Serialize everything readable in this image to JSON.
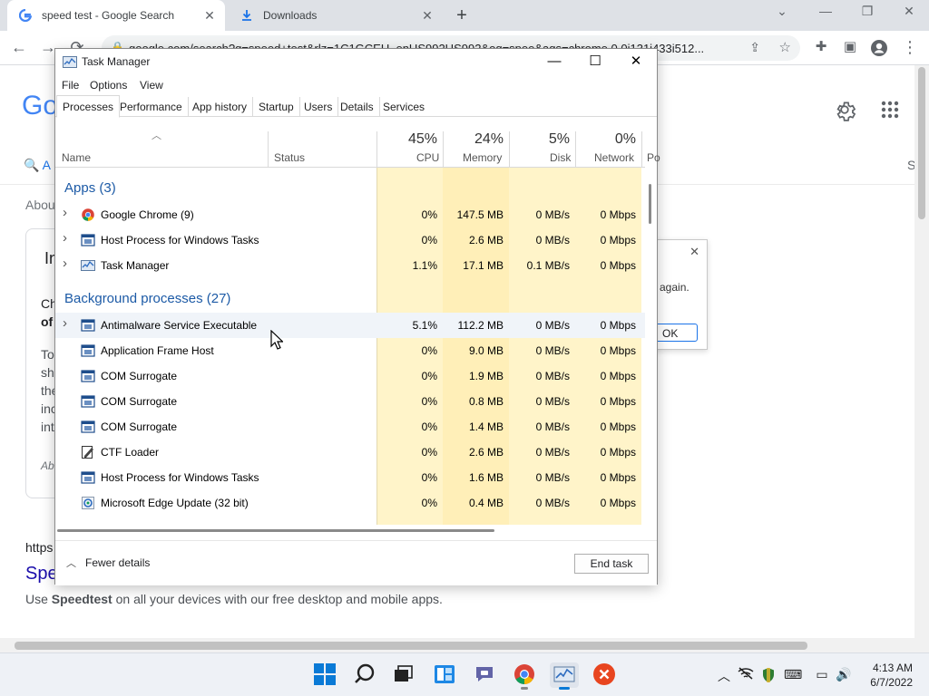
{
  "browser": {
    "tabs": [
      {
        "title": "speed test - Google Search",
        "active": true
      },
      {
        "title": "Downloads",
        "active": false
      }
    ],
    "new_tab": "+",
    "address": "google.com/search?q=speed+test&rlz=1C1GCEU_enUS992US992&oq=spee&aqs=chrome.0.0i131i433i512...",
    "nav": {
      "back": "←",
      "forward": "→",
      "reload": "⟳"
    }
  },
  "page": {
    "logo_partial": "Go",
    "search_tab_partial": "A",
    "about_partial": "Abou",
    "card_title_partial": "In",
    "card_lines": [
      "Ch",
      "of",
      "To",
      "sh",
      "the",
      "inc",
      "int"
    ],
    "card_italic_partial": "Ab",
    "url_partial": "https",
    "result_title_partial": "Spe",
    "result_snippet_prefix": "Use ",
    "result_snippet_bold": "Speedtest",
    "result_snippet_suffix": " on all your devices with our free desktop and mobile apps.",
    "right_tab_partial": "S"
  },
  "dialog_behind": {
    "text": "again.",
    "ok": "OK",
    "close": "✕"
  },
  "task_manager": {
    "title": "Task Manager",
    "menu": [
      "File",
      "Options",
      "View"
    ],
    "tabs": [
      "Processes",
      "Performance",
      "App history",
      "Startup",
      "Users",
      "Details",
      "Services"
    ],
    "columns": {
      "name": "Name",
      "status": "Status",
      "cpu": {
        "pct": "45%",
        "label": "CPU"
      },
      "memory": {
        "pct": "24%",
        "label": "Memory"
      },
      "disk": {
        "pct": "5%",
        "label": "Disk"
      },
      "network": {
        "pct": "0%",
        "label": "Network"
      },
      "power_partial": "Po"
    },
    "groups": {
      "apps": "Apps (3)",
      "background": "Background processes (27)"
    },
    "apps": [
      {
        "name": "Google Chrome (9)",
        "icon": "chrome-icon",
        "cpu": "0%",
        "memory": "147.5 MB",
        "disk": "0 MB/s",
        "network": "0 Mbps"
      },
      {
        "name": "Host Process for Windows Tasks",
        "icon": "window-process-icon",
        "cpu": "0%",
        "memory": "2.6 MB",
        "disk": "0 MB/s",
        "network": "0 Mbps"
      },
      {
        "name": "Task Manager",
        "icon": "task-manager-icon",
        "cpu": "1.1%",
        "memory": "17.1 MB",
        "disk": "0.1 MB/s",
        "network": "0 Mbps"
      }
    ],
    "background": [
      {
        "name": "Antimalware Service Executable",
        "icon": "window-process-icon",
        "expand": true,
        "cpu": "5.1%",
        "memory": "112.2 MB",
        "disk": "0 MB/s",
        "network": "0 Mbps"
      },
      {
        "name": "Application Frame Host",
        "icon": "window-process-icon",
        "expand": false,
        "cpu": "0%",
        "memory": "9.0 MB",
        "disk": "0 MB/s",
        "network": "0 Mbps"
      },
      {
        "name": "COM Surrogate",
        "icon": "window-process-icon",
        "expand": false,
        "cpu": "0%",
        "memory": "1.9 MB",
        "disk": "0 MB/s",
        "network": "0 Mbps"
      },
      {
        "name": "COM Surrogate",
        "icon": "window-process-icon",
        "expand": false,
        "cpu": "0%",
        "memory": "0.8 MB",
        "disk": "0 MB/s",
        "network": "0 Mbps"
      },
      {
        "name": "COM Surrogate",
        "icon": "window-process-icon",
        "expand": false,
        "cpu": "0%",
        "memory": "1.4 MB",
        "disk": "0 MB/s",
        "network": "0 Mbps"
      },
      {
        "name": "CTF Loader",
        "icon": "ctf-loader-icon",
        "expand": false,
        "cpu": "0%",
        "memory": "2.6 MB",
        "disk": "0 MB/s",
        "network": "0 Mbps"
      },
      {
        "name": "Host Process for Windows Tasks",
        "icon": "window-process-icon",
        "expand": false,
        "cpu": "0%",
        "memory": "1.6 MB",
        "disk": "0 MB/s",
        "network": "0 Mbps"
      },
      {
        "name": "Microsoft Edge Update (32 bit)",
        "icon": "edge-update-icon",
        "expand": false,
        "cpu": "0%",
        "memory": "0.4 MB",
        "disk": "0 MB/s",
        "network": "0 Mbps"
      }
    ],
    "fewer_details": "Fewer details",
    "end_task": "End task",
    "colors": {
      "col_light": "#fff9e0",
      "col_med": "#fff2c2",
      "col_hot": "#ffe9a8",
      "group_text": "#1c5aa6"
    }
  },
  "taskbar": {
    "apps": [
      "start-icon",
      "search-icon",
      "task-view-icon",
      "widgets-icon",
      "teams-chat-icon",
      "chrome-icon",
      "task-manager-icon",
      "app-close-icon"
    ],
    "clock": {
      "time": "4:13 AM",
      "date": "6/7/2022"
    }
  }
}
